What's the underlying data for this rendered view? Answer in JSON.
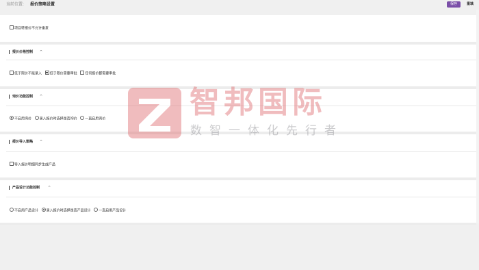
{
  "header": {
    "breadcrumb_label": "当前位置:",
    "breadcrumb_value": "报价策略设置",
    "save_label": "保存",
    "reset_label": "重填"
  },
  "sections": [
    {
      "title": "",
      "options": [
        {
          "type": "checkbox",
          "label": "项目转报价不允许重复",
          "checked": false
        }
      ]
    },
    {
      "title": "报价价格控制",
      "options": [
        {
          "type": "checkbox",
          "label": "低于限价不能录入",
          "checked": false
        },
        {
          "type": "checkbox",
          "label": "低于限价需要审批",
          "checked": true
        },
        {
          "type": "checkbox",
          "label": "任何报价都需要审批",
          "checked": false
        }
      ]
    },
    {
      "title": "询价功能控制",
      "options": [
        {
          "type": "radio",
          "label": "不启用询价",
          "checked": true
        },
        {
          "type": "radio",
          "label": "录入报价时选择是否询价",
          "checked": false
        },
        {
          "type": "radio",
          "label": "一直启用询价",
          "checked": false
        }
      ]
    },
    {
      "title": "报价导入策略",
      "options": [
        {
          "type": "checkbox",
          "label": "导入报价明细同步生成产品",
          "checked": false
        }
      ]
    },
    {
      "title": "产品设计功能控制",
      "options": [
        {
          "type": "radio",
          "label": "不启用产品设计",
          "checked": false
        },
        {
          "type": "radio",
          "label": "录入报价时选择是否产品设计",
          "checked": true
        },
        {
          "type": "radio",
          "label": "一直启用产品设计",
          "checked": false
        }
      ]
    }
  ],
  "chevron_glyph": "^",
  "watermark": {
    "logo_letter": "Z",
    "title": "智邦国际",
    "slogan": "数智一体化先行者"
  },
  "colors": {
    "accent": "#7b4fa8",
    "watermark_red": "#e06c70",
    "watermark_gray": "#8f8f95"
  }
}
